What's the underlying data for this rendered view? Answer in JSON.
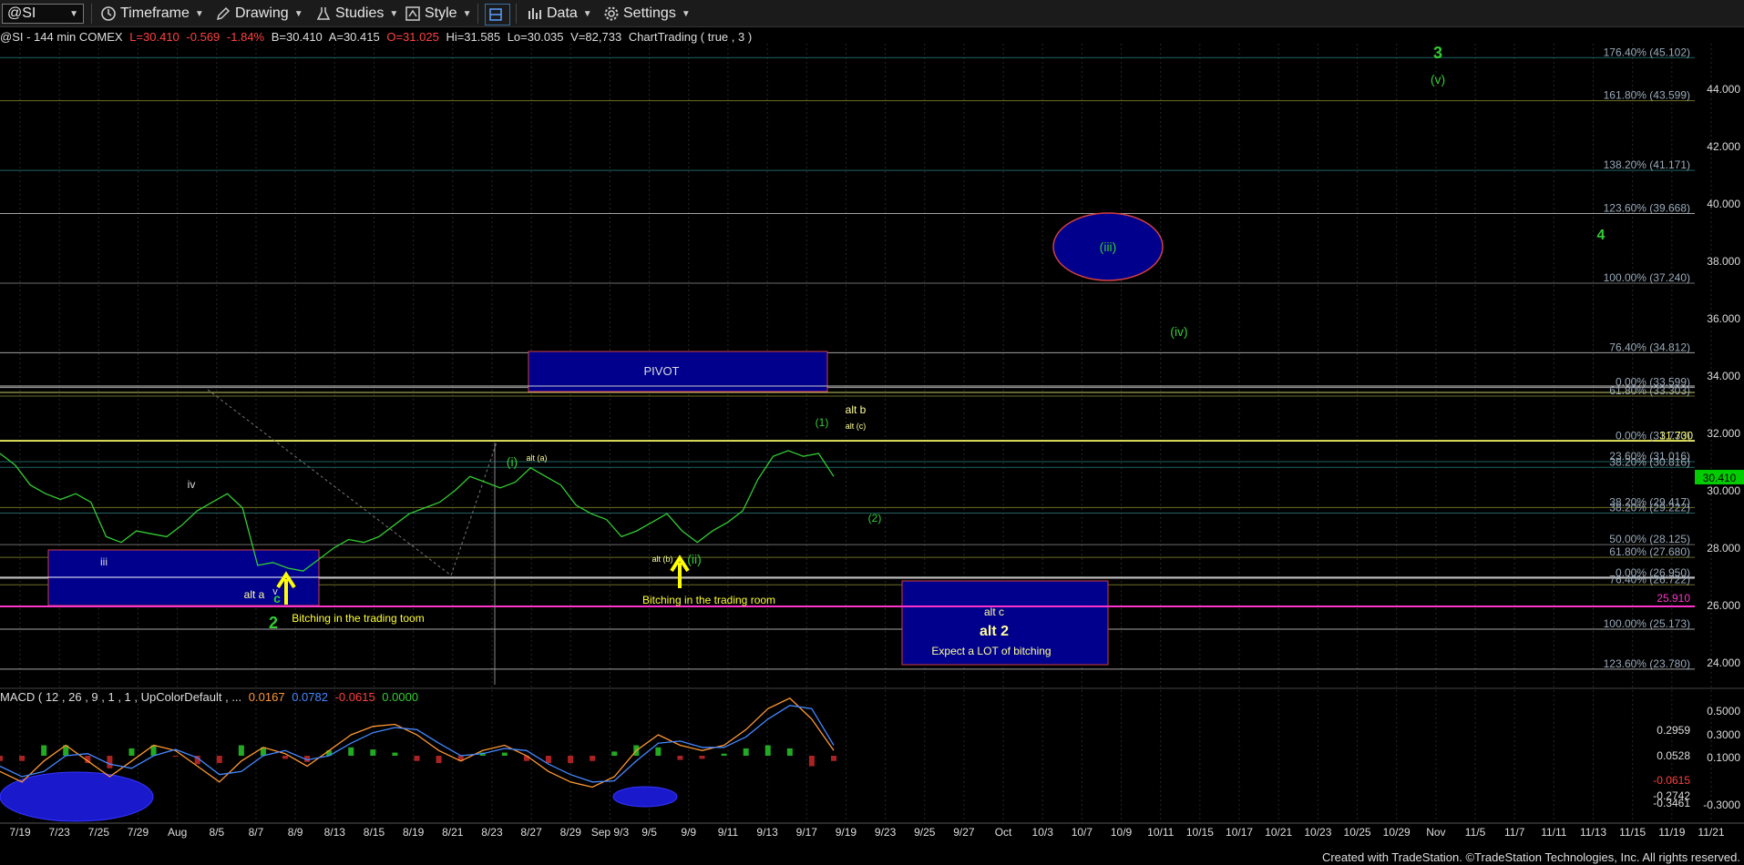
{
  "toolbar": {
    "symbol": "@SI",
    "timeframe": "Timeframe",
    "drawing": "Drawing",
    "studies": "Studies",
    "style": "Style",
    "data": "Data",
    "settings": "Settings"
  },
  "info": {
    "header": "@SI - 144 min  COMEX",
    "last": "L=30.410",
    "change": "-0.569",
    "pct": "-1.84%",
    "bid": "B=30.410",
    "ask": "A=30.415",
    "open": "O=31.025",
    "high": "Hi=31.585",
    "low": "Lo=30.035",
    "volume": "V=82,733",
    "study": "ChartTrading ( true , 3 )"
  },
  "macd_label": {
    "prefix": "MACD ( 12 , 26 , 9 , 1 , 1 , UpColorDefault , ...",
    "v1": "0.0167",
    "v2": "0.0782",
    "v3": "-0.0615",
    "v4": "0.0000"
  },
  "footer": "Created with TradeStation. ©TradeStation Technologies, Inc. All rights reserved.",
  "colors": {
    "background": "#000000",
    "price_line": "#33cc33",
    "macd_line": "#ff9933",
    "signal_line": "#4488ff",
    "box_fill": "#000099",
    "pink_line": "#ff33cc",
    "yellow": "#ffff00",
    "fib_green": "#1f5f5f"
  },
  "chart_data": {
    "type": "line",
    "price_axis": {
      "ticks": [
        "44.000",
        "42.000",
        "40.000",
        "38.000",
        "36.000",
        "34.000",
        "32.000",
        "30.000",
        "28.000",
        "26.000",
        "24.000"
      ],
      "last_price": "30.410",
      "pink_level": "25.910"
    },
    "date_axis": [
      "7/19",
      "7/23",
      "7/25",
      "7/29",
      "Aug",
      "8/5",
      "8/7",
      "8/9",
      "8/13",
      "8/15",
      "8/19",
      "8/21",
      "8/23",
      "8/27",
      "8/29",
      "Sep 9/3",
      "9/5",
      "9/9",
      "9/11",
      "9/13",
      "9/17",
      "9/19",
      "9/23",
      "9/25",
      "9/27",
      "Oct",
      "10/3",
      "10/7",
      "10/9",
      "10/11",
      "10/15",
      "10/17",
      "10/21",
      "10/23",
      "10/25",
      "10/29",
      "Nov",
      "11/5",
      "11/7",
      "11/11",
      "11/13",
      "11/15",
      "11/19",
      "11/21"
    ],
    "fib_labels": [
      {
        "text": "176.40% (45.102)",
        "value": 45.102
      },
      {
        "text": "161.80% (43.599)",
        "value": 43.599
      },
      {
        "text": "138.20% (41.171)",
        "value": 41.171
      },
      {
        "text": "123.60% (39.668)",
        "value": 39.668
      },
      {
        "text": "100.00% (37.240)",
        "value": 37.24
      },
      {
        "text": "76.40% (34.812)",
        "value": 34.812
      },
      {
        "text": "0.00% (33.599)",
        "value": 33.599
      },
      {
        "text": "61.80% (33.303)",
        "value": 33.303
      },
      {
        "text": "0.00% (31.730)",
        "value": 31.73
      },
      {
        "text": "31.730",
        "value": 31.73
      },
      {
        "text": "23.60% (31.016)",
        "value": 31.016
      },
      {
        "text": "38.20% (30.816)",
        "value": 30.816
      },
      {
        "text": "38.20% (29.417)",
        "value": 29.417
      },
      {
        "text": "38.20% (29.222)",
        "value": 29.222
      },
      {
        "text": "50.00% (28.125)",
        "value": 28.125
      },
      {
        "text": "61.80% (27.680)",
        "value": 27.68
      },
      {
        "text": "0.00% (26.950)",
        "value": 26.95
      },
      {
        "text": "76.40% (26.722)",
        "value": 26.722
      },
      {
        "text": "100.00% (25.173)",
        "value": 25.173
      },
      {
        "text": "123.60% (23.780)",
        "value": 23.78
      }
    ],
    "wave_labels": {
      "w3": "3",
      "wv": "(v)",
      "w4": "4",
      "wiv": "(iv)",
      "wiii": "(iii)",
      "w1": "(1)",
      "w2": "(2)",
      "wi": "(i)",
      "wii": "(ii)",
      "iii": "iii",
      "iv": "iv",
      "v": "v",
      "c": "c",
      "wave2": "2",
      "alt_a": "alt a",
      "alt_a_paren": "alt (a)",
      "alt_b": "alt b",
      "alt_c_paren": "alt (c)",
      "alt_b_paren": "alt (b)",
      "alt_c": "alt c",
      "alt_2": "alt 2"
    },
    "annotations": {
      "pivot": "PIVOT",
      "bitching1": "Bitching in the trading toom",
      "bitching2": "Bitching in the trading room",
      "expect": "Expect a LOT of bitching"
    },
    "price_series": [
      31.3,
      30.9,
      30.2,
      29.9,
      29.7,
      29.9,
      29.6,
      28.4,
      28.2,
      28.6,
      28.5,
      28.4,
      28.8,
      29.3,
      29.6,
      29.9,
      29.4,
      27.4,
      27.5,
      27.3,
      27.2,
      27.6,
      28.0,
      28.3,
      28.2,
      28.4,
      28.8,
      29.2,
      29.4,
      29.6,
      30.0,
      30.5,
      30.3,
      30.1,
      30.3,
      30.8,
      30.5,
      30.2,
      29.5,
      29.2,
      29.0,
      28.4,
      28.6,
      28.9,
      29.2,
      28.6,
      28.2,
      28.6,
      28.9,
      29.3,
      30.4,
      31.2,
      31.4,
      31.2,
      31.3,
      30.5
    ],
    "macd": {
      "ticks": [
        "0.5000",
        "0.2959",
        "0.3000",
        "0.1000",
        "0.0528",
        "-0.0615",
        "-0.2742",
        "-0.3461",
        "-0.3000"
      ],
      "macd_series": [
        -0.15,
        -0.25,
        -0.05,
        0.1,
        -0.05,
        -0.2,
        -0.05,
        0.1,
        0.05,
        -0.1,
        -0.25,
        -0.05,
        0.08,
        0.02,
        -0.1,
        0.05,
        0.2,
        0.28,
        0.3,
        0.2,
        0.05,
        -0.05,
        0.05,
        0.1,
        0.0,
        -0.15,
        -0.25,
        -0.3,
        -0.2,
        0.05,
        0.2,
        0.1,
        0.05,
        0.1,
        0.25,
        0.45,
        0.55,
        0.35,
        0.05
      ],
      "signal_series": [
        -0.1,
        -0.2,
        -0.15,
        0.0,
        0.02,
        -0.08,
        -0.12,
        0.0,
        0.06,
        -0.02,
        -0.18,
        -0.15,
        0.0,
        0.05,
        -0.04,
        0.0,
        0.12,
        0.22,
        0.27,
        0.25,
        0.12,
        0.0,
        0.02,
        0.07,
        0.05,
        -0.08,
        -0.18,
        -0.25,
        -0.24,
        -0.05,
        0.12,
        0.14,
        0.08,
        0.08,
        0.18,
        0.35,
        0.48,
        0.45,
        0.1
      ]
    }
  }
}
